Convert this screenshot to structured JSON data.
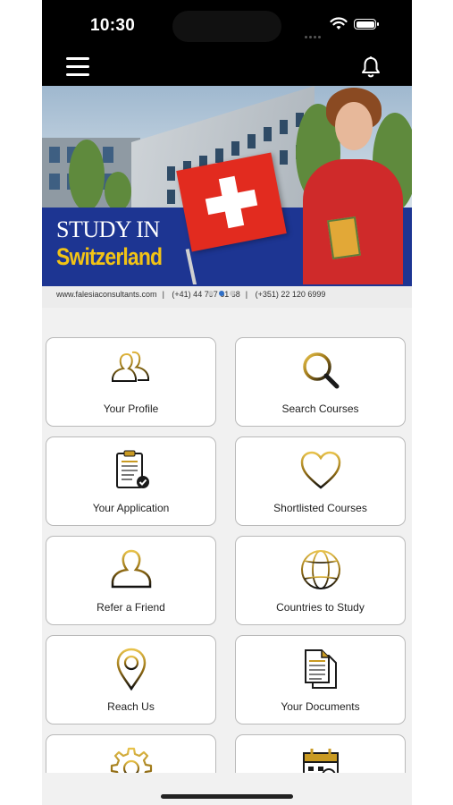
{
  "status": {
    "time": "10:30"
  },
  "banner": {
    "line1": "STUDY IN",
    "line2": "Switzerland",
    "website": "www.falesiaconsultants.com",
    "phone1": "(+41) 44 797 61 68",
    "phone2": "(+351) 22 120 6999",
    "slides": 3,
    "active_slide": 1
  },
  "tiles": [
    {
      "label": "Your Profile",
      "icon": "profile-icon"
    },
    {
      "label": "Search Courses",
      "icon": "search-icon"
    },
    {
      "label": "Your Application",
      "icon": "application-icon"
    },
    {
      "label": "Shortlisted Courses",
      "icon": "heart-icon"
    },
    {
      "label": "Refer a Friend",
      "icon": "person-icon"
    },
    {
      "label": "Countries to Study",
      "icon": "globe-icon"
    },
    {
      "label": "Reach Us",
      "icon": "location-pin-icon"
    },
    {
      "label": "Your Documents",
      "icon": "documents-icon"
    },
    {
      "label": "",
      "icon": "gear-icon"
    },
    {
      "label": "",
      "icon": "calendar-icon"
    }
  ],
  "colors": {
    "accent_gold": "#b8860b",
    "banner_blue": "#1d3592",
    "flag_red": "#e22b1f"
  }
}
